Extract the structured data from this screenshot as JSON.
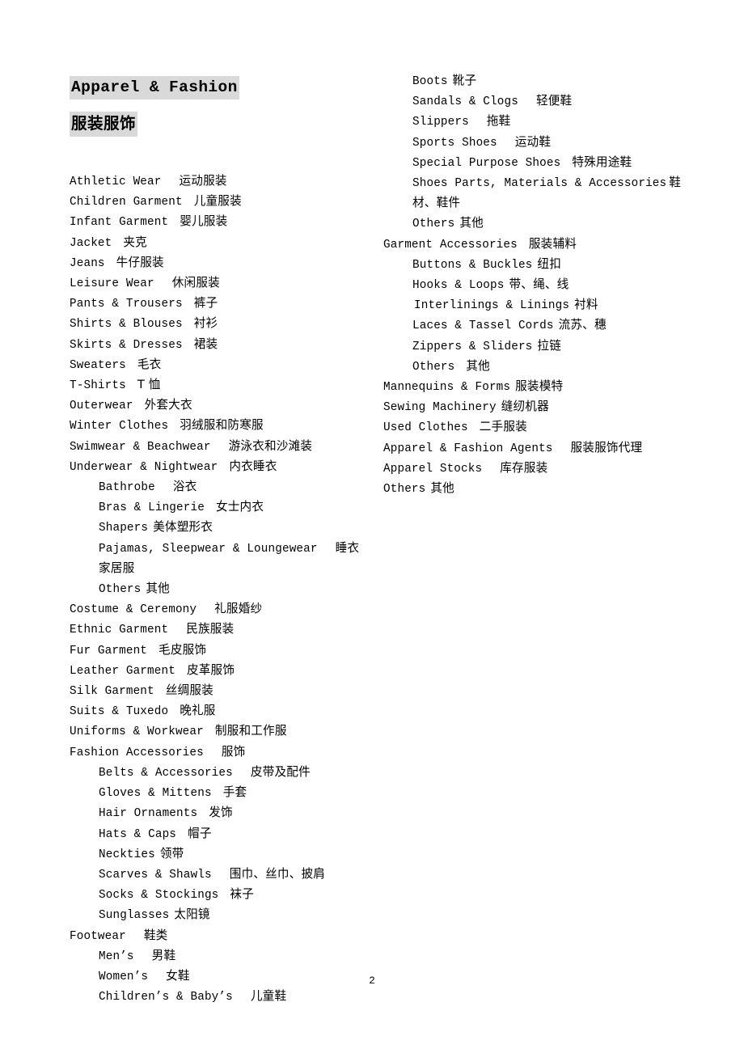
{
  "document": {
    "title_en": "Apparel & Fashion",
    "title_cn": "服装服饰",
    "page_number": "2",
    "highlight_color": "#d9d9d9",
    "text_color": "#000000",
    "background_color": "#ffffff"
  },
  "left_column": [
    {
      "level": 0,
      "en": "Athletic Wear",
      "gap": 3,
      "cn": "运动服装"
    },
    {
      "level": 0,
      "en": "Children Garment",
      "gap": 2,
      "cn": "儿童服装"
    },
    {
      "level": 0,
      "en": "Infant Garment",
      "gap": 2,
      "cn": "婴儿服装"
    },
    {
      "level": 0,
      "en": "Jacket",
      "gap": 2,
      "cn": "夹克"
    },
    {
      "level": 0,
      "en": "Jeans",
      "gap": 2,
      "cn": "牛仔服装"
    },
    {
      "level": 0,
      "en": "Leisure Wear",
      "gap": 3,
      "cn": "休闲服装"
    },
    {
      "level": 0,
      "en": "Pants & Trousers",
      "gap": 2,
      "cn": "裤子"
    },
    {
      "level": 0,
      "en": "Shirts & Blouses",
      "gap": 2,
      "cn": "衬衫"
    },
    {
      "level": 0,
      "en": "Skirts & Dresses",
      "gap": 2,
      "cn": "裙装"
    },
    {
      "level": 0,
      "en": "Sweaters",
      "gap": 2,
      "cn": "毛衣"
    },
    {
      "level": 0,
      "en": "T-Shirts",
      "gap": 2,
      "cn": "T 恤"
    },
    {
      "level": 0,
      "en": "Outerwear",
      "gap": 2,
      "cn": "外套大衣"
    },
    {
      "level": 0,
      "en": "Winter Clothes",
      "gap": 2,
      "cn": "羽绒服和防寒服"
    },
    {
      "level": 0,
      "en": "Swimwear & Beachwear",
      "gap": 3,
      "cn": "游泳衣和沙滩装"
    },
    {
      "level": 0,
      "en": "Underwear & Nightwear",
      "gap": 2,
      "cn": "内衣睡衣"
    },
    {
      "level": 1,
      "en": "Bathrobe",
      "gap": 3,
      "cn": "浴衣"
    },
    {
      "level": 1,
      "en": "Bras & Lingerie",
      "gap": 2,
      "cn": "女士内衣"
    },
    {
      "level": 1,
      "en": "Shapers",
      "gap": 1,
      "cn": "美体塑形衣"
    },
    {
      "level": 1,
      "en": "Pajamas, Sleepwear & Loungewear",
      "gap": 3,
      "cn": "睡衣家居服"
    },
    {
      "level": 1,
      "en": "Others",
      "gap": 1,
      "cn": "其他"
    },
    {
      "level": 0,
      "en": "Costume & Ceremony",
      "gap": 3,
      "cn": "礼服婚纱"
    },
    {
      "level": 0,
      "en": "Ethnic Garment",
      "gap": 3,
      "cn": "民族服装"
    },
    {
      "level": 0,
      "en": "Fur Garment",
      "gap": 2,
      "cn": "毛皮服饰"
    },
    {
      "level": 0,
      "en": "Leather Garment",
      "gap": 2,
      "cn": "皮革服饰"
    },
    {
      "level": 0,
      "en": "Silk Garment",
      "gap": 2,
      "cn": "丝绸服装"
    },
    {
      "level": 0,
      "en": "Suits & Tuxedo",
      "gap": 2,
      "cn": "晚礼服"
    },
    {
      "level": 0,
      "en": "Uniforms & Workwear",
      "gap": 2,
      "cn": "制服和工作服"
    },
    {
      "level": 0,
      "en": "Fashion Accessories",
      "gap": 3,
      "cn": "服饰"
    },
    {
      "level": 1,
      "en": "Belts & Accessories",
      "gap": 3,
      "cn": "皮带及配件"
    },
    {
      "level": 1,
      "en": "Gloves & Mittens",
      "gap": 2,
      "cn": "手套"
    },
    {
      "level": 1,
      "en": "Hair Ornaments",
      "gap": 2,
      "cn": "发饰"
    },
    {
      "level": 1,
      "en": "Hats & Caps",
      "gap": 2,
      "cn": "帽子"
    },
    {
      "level": 1,
      "en": "Neckties",
      "gap": 1,
      "cn": "领带"
    },
    {
      "level": 1,
      "en": "Scarves & Shawls",
      "gap": 3,
      "cn": "围巾、丝巾、披肩"
    },
    {
      "level": 1,
      "en": "Socks & Stockings",
      "gap": 2,
      "cn": "袜子"
    },
    {
      "level": 1,
      "en": "Sunglasses",
      "gap": 1,
      "cn": "太阳镜"
    },
    {
      "level": 0,
      "en": "Footwear",
      "gap": 3,
      "cn": "鞋类"
    },
    {
      "level": 1,
      "en": "Men’s",
      "gap": 3,
      "cn": "男鞋"
    },
    {
      "level": 1,
      "en": "Women’s",
      "gap": 3,
      "cn": "女鞋"
    },
    {
      "level": 1,
      "en": "Children’s & Baby’s",
      "gap": 3,
      "cn": "儿童鞋"
    }
  ],
  "right_column": [
    {
      "level": 1,
      "en": "Boots",
      "gap": 1,
      "cn": "靴子"
    },
    {
      "level": 1,
      "en": "Sandals & Clogs",
      "gap": 3,
      "cn": "轻便鞋"
    },
    {
      "level": 1,
      "en": "Slippers",
      "gap": 3,
      "cn": "拖鞋"
    },
    {
      "level": 1,
      "en": "Sports Shoes",
      "gap": 3,
      "cn": "运动鞋"
    },
    {
      "level": 1,
      "en": "Special Purpose Shoes",
      "gap": 2,
      "cn": "特殊用途鞋"
    },
    {
      "level": 1,
      "en": "Shoes Parts, Materials & Accessories",
      "gap": 0,
      "cn": "鞋材、鞋件"
    },
    {
      "level": 1,
      "en": "Others",
      "gap": 1,
      "cn": "其他"
    },
    {
      "level": 0,
      "en": "Garment Accessories",
      "gap": 2,
      "cn": "服装辅料"
    },
    {
      "level": 1,
      "en": "Buttons & Buckles",
      "gap": 1,
      "cn": "纽扣"
    },
    {
      "level": 1,
      "en": "Hooks & Loops",
      "gap": 1,
      "cn": "带、绳、线"
    },
    {
      "level": 1,
      "en": "Interlinings & Linings",
      "gap": 1,
      "cn": "衬料",
      "extra_indent": true
    },
    {
      "level": 1,
      "en": "Laces & Tassel Cords",
      "gap": 1,
      "cn": "流苏、穗"
    },
    {
      "level": 1,
      "en": "Zippers & Sliders",
      "gap": 1,
      "cn": "拉链"
    },
    {
      "level": 1,
      "en": "Others",
      "gap": 2,
      "cn": "其他"
    },
    {
      "level": 0,
      "en": "Mannequins & Forms",
      "gap": 1,
      "cn": "服装模特"
    },
    {
      "level": 0,
      "en": "Sewing Machinery",
      "gap": 1,
      "cn": "缝纫机器"
    },
    {
      "level": 0,
      "en": "Used Clothes",
      "gap": 2,
      "cn": "二手服装"
    },
    {
      "level": 0,
      "en": "Apparel & Fashion Agents",
      "gap": 3,
      "cn": "服装服饰代理"
    },
    {
      "level": 0,
      "en": "Apparel Stocks",
      "gap": 3,
      "cn": "库存服装"
    },
    {
      "level": 0,
      "en": "Others",
      "gap": 1,
      "cn": "其他"
    }
  ]
}
